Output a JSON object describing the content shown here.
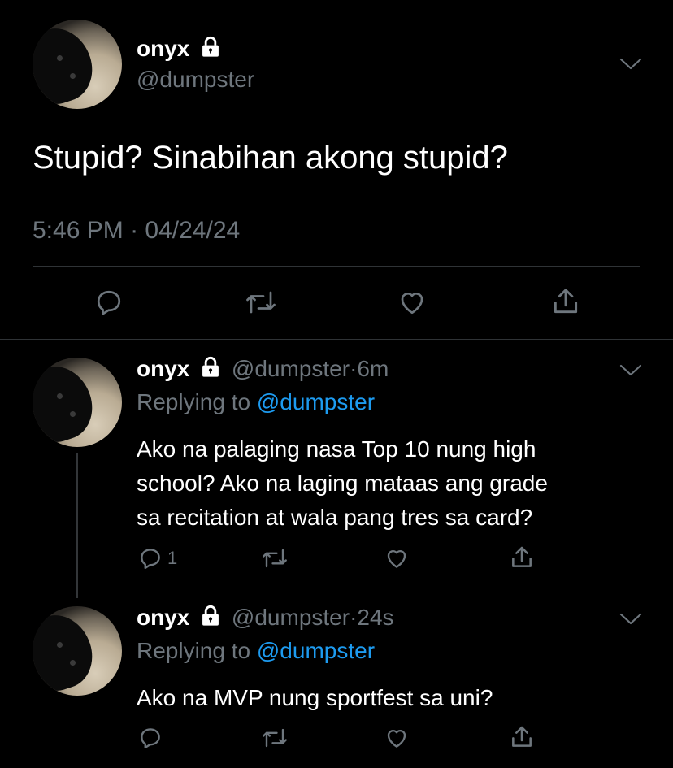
{
  "main_tweet": {
    "name": "onyx",
    "handle": "@dumpster",
    "text": "Stupid? Sinabihan akong stupid?",
    "time": "5:46 PM",
    "date": "04/24/24"
  },
  "replies": [
    {
      "name": "onyx",
      "handle": "@dumpster",
      "age": "6m",
      "replying_prefix": "Replying to",
      "replying_handle": "@dumpster",
      "text_lines": [
        "Ako na palaging nasa Top 10 nung high",
        "school? Ako na laging mataas ang grade",
        "sa recitation at wala pang tres sa card?"
      ],
      "reply_count": "1"
    },
    {
      "name": "onyx",
      "handle": "@dumpster",
      "age": "24s",
      "replying_prefix": "Replying to",
      "replying_handle": "@dumpster",
      "text_lines": [
        "Ako na MVP nung sportfest sa uni?"
      ],
      "reply_count": ""
    }
  ],
  "icons": {
    "reply": "reply-icon",
    "retweet": "retweet-icon",
    "like": "heart-icon",
    "share": "share-icon",
    "lock": "lock-icon",
    "more": "chevron-down-icon"
  },
  "colors": {
    "background": "#000000",
    "text": "#ffffff",
    "secondary": "#6e767d",
    "link": "#1d9bf0"
  }
}
